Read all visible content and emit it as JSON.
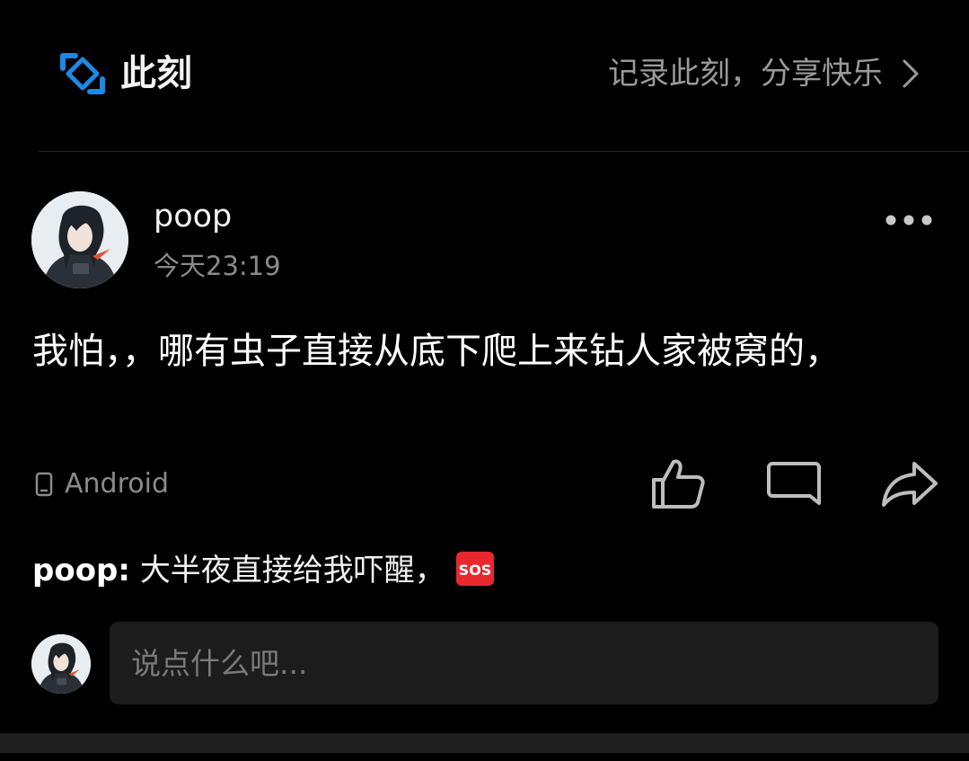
{
  "header": {
    "logo_icon": "moment-logo-icon",
    "title": "此刻",
    "link_text": "记录此刻，分享快乐",
    "accent_color": "#1e88e5"
  },
  "post": {
    "username": "poop",
    "timestamp": "今天23:19",
    "content": "我怕，，哪有虫子直接从底下爬上来钻人家被窝的，",
    "device": "Android",
    "actions": {
      "like_icon": "thumbs-up-icon",
      "comment_icon": "comment-icon",
      "share_icon": "share-icon"
    }
  },
  "comment": {
    "author": "poop:",
    "text": "大半夜直接给我吓醒，",
    "emoji": "🆘",
    "emoji_text": "SOS"
  },
  "input": {
    "placeholder": "说点什么吧..."
  }
}
